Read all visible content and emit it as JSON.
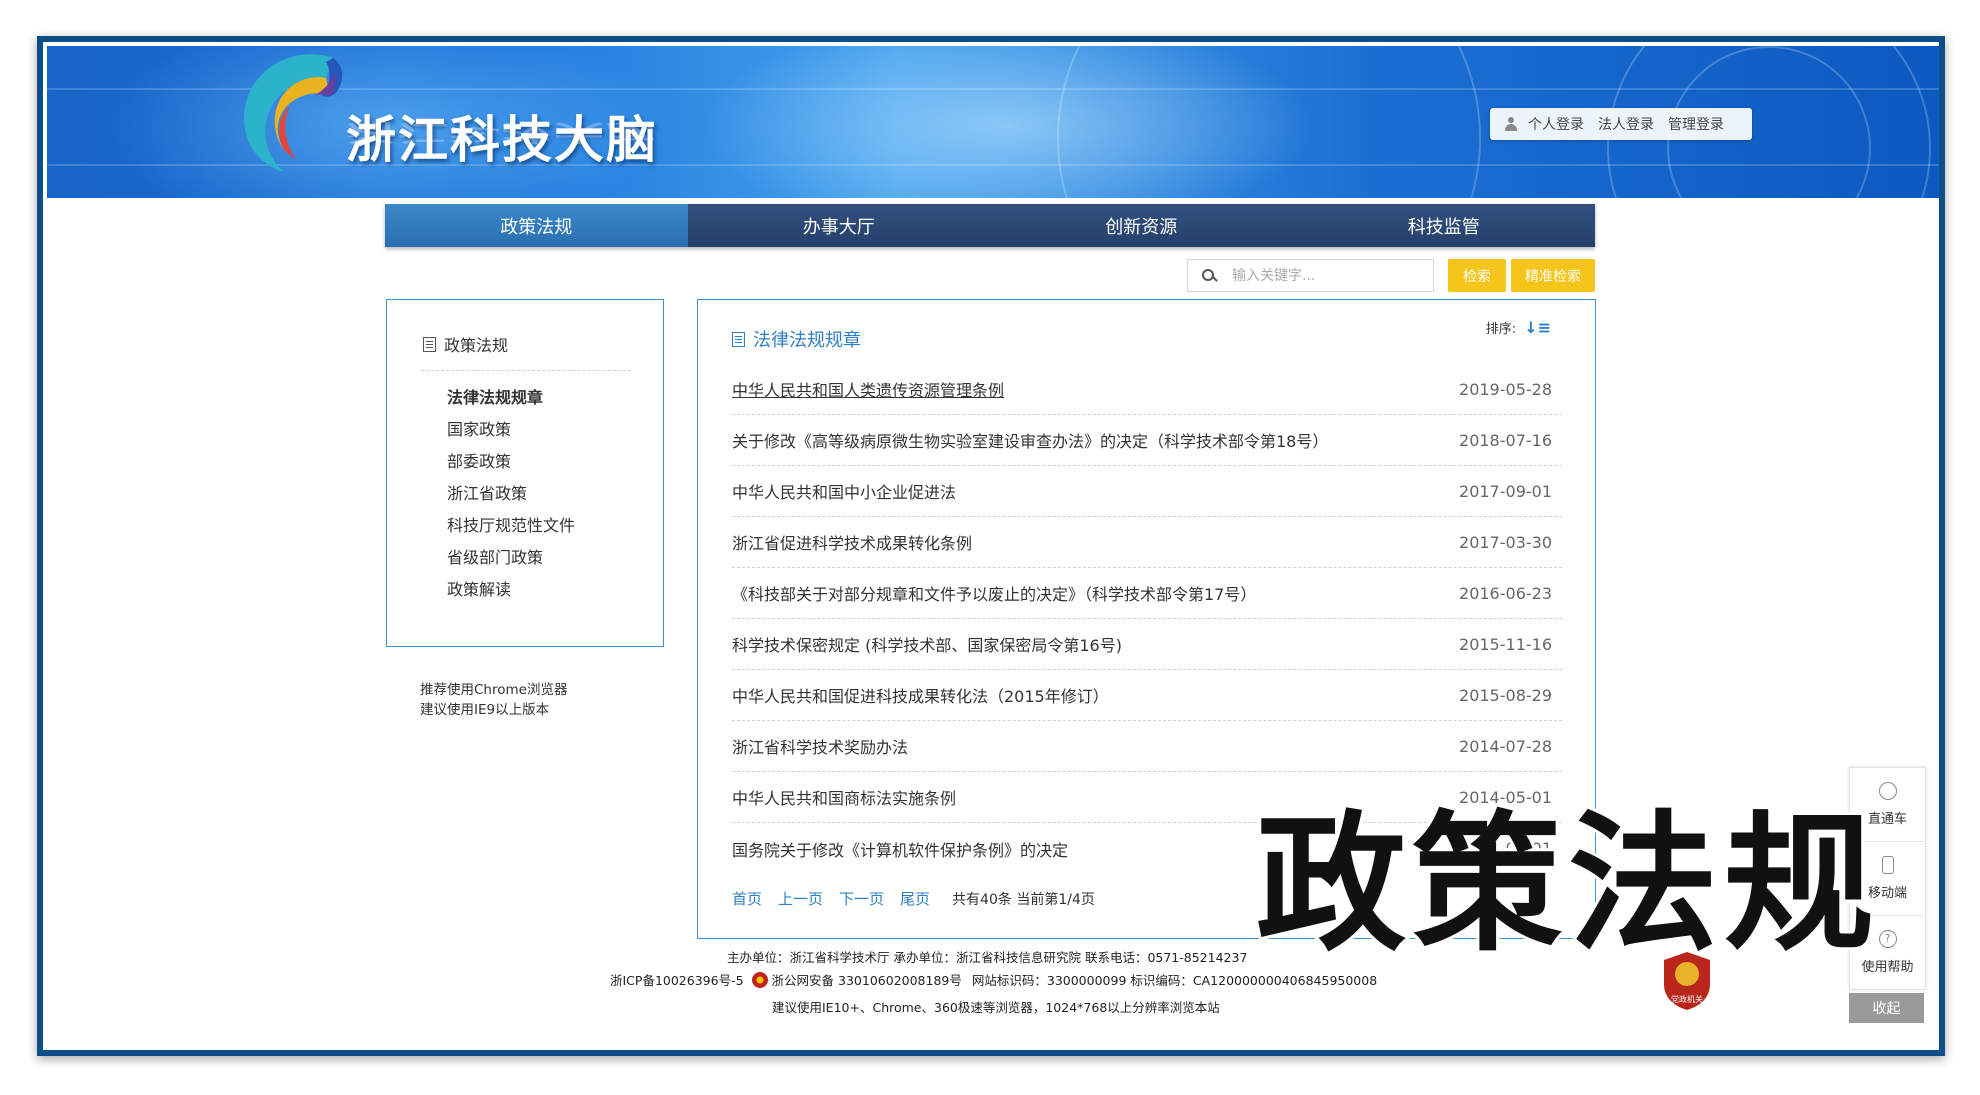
{
  "header": {
    "logo_text": "浙江科技大脑",
    "login_links": [
      "个人登录",
      "法人登录",
      "管理登录"
    ]
  },
  "nav": {
    "items": [
      "政策法规",
      "办事大厅",
      "创新资源",
      "科技监管"
    ],
    "active_index": 0
  },
  "search": {
    "placeholder": "输入关键字...",
    "search_label": "检索",
    "precise_label": "精准检索"
  },
  "sidebar": {
    "title": "政策法规",
    "items": [
      "法律法规规章",
      "国家政策",
      "部委政策",
      "浙江省政策",
      "科技厅规范性文件",
      "省级部门政策",
      "政策解读"
    ],
    "active_index": 0,
    "browser_note_1": "推荐使用Chrome浏览器",
    "browser_note_2": "建议使用IE9以上版本"
  },
  "main": {
    "title": "法律法规规章",
    "sort_label": "排序:",
    "rows": [
      {
        "title": "中华人民共和国人类遗传资源管理条例",
        "date": "2019-05-28"
      },
      {
        "title": "关于修改《高等级病原微生物实验室建设审查办法》的决定（科学技术部令第18号）",
        "date": "2018-07-16"
      },
      {
        "title": "中华人民共和国中小企业促进法",
        "date": "2017-09-01"
      },
      {
        "title": "浙江省促进科学技术成果转化条例",
        "date": "2017-03-30"
      },
      {
        "title": "《科技部关于对部分规章和文件予以废止的决定》（科学技术部令第17号）",
        "date": "2016-06-23"
      },
      {
        "title": "科学技术保密规定 (科学技术部、国家保密局令第16号)",
        "date": "2015-11-16"
      },
      {
        "title": "中华人民共和国促进科技成果转化法（2015年修订）",
        "date": "2015-08-29"
      },
      {
        "title": "浙江省科学技术奖励办法",
        "date": "2014-07-28"
      },
      {
        "title": "中华人民共和国商标法实施条例",
        "date": "2014-05-01"
      },
      {
        "title": "国务院关于修改《计算机软件保护条例》的决定",
        "date": "2013-03-01"
      }
    ],
    "pager": {
      "first": "首页",
      "prev": "上一页",
      "next": "下一页",
      "last": "尾页",
      "info": "共有40条 当前第1/4页"
    }
  },
  "footer": {
    "line1": "主办单位：浙江省科学技术厅   承办单位：浙江省科技信息研究院   联系电话：0571-85214237",
    "icp": "浙ICP备10026396号-5",
    "police": "浙公网安备 33010602008189号",
    "site_id": "网站标识码：3300000099   标识编码：CA120000000406845950008",
    "line3": "建议使用IE10+、Chrome、360极速等浏览器，1024*768以上分辨率浏览本站",
    "badge_text": "党政机关"
  },
  "float_panel": {
    "items": [
      "直通车",
      "移动端",
      "使用帮助"
    ],
    "collapse": "收起"
  },
  "overlay_caption": "政策法规"
}
